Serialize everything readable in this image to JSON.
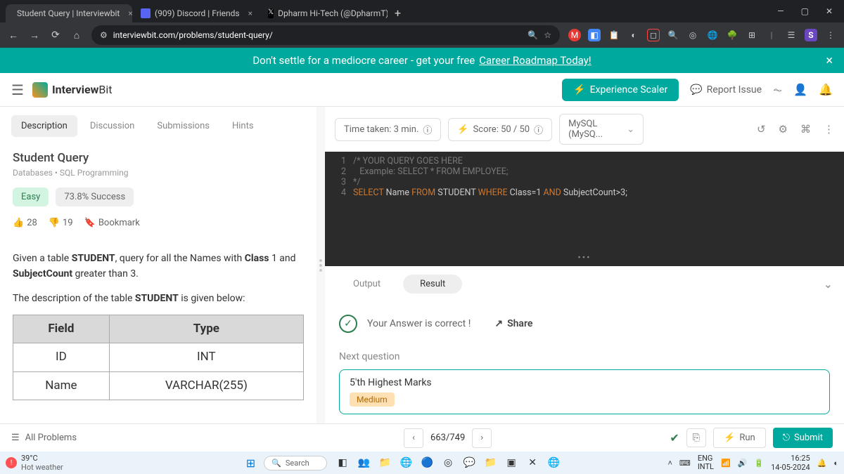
{
  "browser": {
    "tabs": [
      {
        "title": "Student Query | Interviewbit",
        "active": true
      },
      {
        "title": "(909) Discord | Friends",
        "active": false
      },
      {
        "title": "Dpharm Hi-Tech (@DpharmT) /",
        "active": false
      }
    ],
    "url": "interviewbit.com/problems/student-query/"
  },
  "banner": {
    "text": "Don't settle for a mediocre career - get your free",
    "link": "Career Roadmap Today!"
  },
  "nav": {
    "brand_a": "Interview",
    "brand_b": "Bit",
    "experience": "Experience Scaler",
    "report": "Report Issue"
  },
  "problem": {
    "tabs": [
      "Description",
      "Discussion",
      "Submissions",
      "Hints"
    ],
    "title": "Student Query",
    "tags": "Databases • SQL Programming",
    "difficulty": "Easy",
    "success": "73.8% Success",
    "upvotes": "28",
    "downvotes": "19",
    "bookmark": "Bookmark",
    "desc_1a": "Given a table ",
    "desc_1b": "STUDENT",
    "desc_1c": ", query for all the Names with ",
    "desc_1d": "Class",
    "desc_1e": " 1 and ",
    "desc_1f": "SubjectCount",
    "desc_1g": " greater than 3.",
    "desc_2a": "The description of the table ",
    "desc_2b": "STUDENT",
    "desc_2c": "  is given below:",
    "schema": {
      "headers": [
        "Field",
        "Type"
      ],
      "rows": [
        [
          "ID",
          "INT"
        ],
        [
          "Name",
          "VARCHAR(255)"
        ]
      ]
    }
  },
  "editor": {
    "time_taken": "Time taken: 3 min.",
    "score": "Score:  50  /  50",
    "language": "MySQL (MySQ...",
    "lines": {
      "l1": "/* YOUR QUERY GOES HERE",
      "l2": "   Example: SELECT * FROM EMPLOYEE;",
      "l3": "*/",
      "l4_select": "SELECT",
      "l4_name": " Name ",
      "l4_from": "FROM",
      "l4_student": " STUDENT ",
      "l4_where": "WHERE",
      "l4_class": " Class=1 ",
      "l4_and": "AND",
      "l4_subject": " SubjectCount>3;"
    }
  },
  "result": {
    "tabs": [
      "Output",
      "Result"
    ],
    "correct": "Your Answer is correct !",
    "share": "Share",
    "next_label": "Next question",
    "next_title": "5'th Highest Marks",
    "next_diff": "Medium"
  },
  "footer": {
    "all_problems": "All Problems",
    "position": "663/749",
    "run": "Run",
    "submit": "Submit"
  },
  "taskbar": {
    "temp": "39°C",
    "weather": "Hot weather",
    "search": "Search",
    "lang_a": "ENG",
    "lang_b": "INTL",
    "time": "16:25",
    "date": "14-05-2024"
  }
}
